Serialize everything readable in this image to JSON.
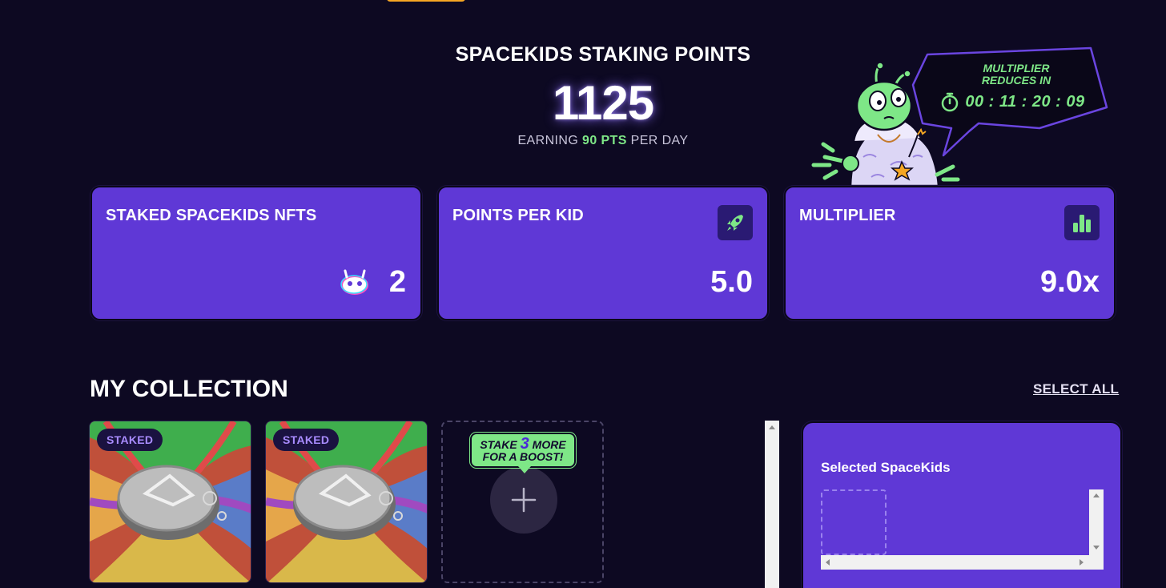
{
  "header": {
    "title": "SPACEKIDS STAKING POINTS",
    "points": "1125",
    "earning_prefix": "EARNING ",
    "earning_value": "90 PTS",
    "earning_suffix": " PER DAY"
  },
  "multiplier_bubble": {
    "label_line1": "MULTIPLIER",
    "label_line2": "REDUCES IN",
    "countdown": "00 : 11 : 20 : 09",
    "icon": "stopwatch-icon"
  },
  "stats": [
    {
      "label": "STAKED SPACEKIDS NFTS",
      "value": "2",
      "icon": "spacekid-icon"
    },
    {
      "label": "POINTS PER KID",
      "value": "5.0",
      "icon": "rocket-icon"
    },
    {
      "label": "MULTIPLIER",
      "value": "9.0x",
      "icon": "bar-chart-icon"
    }
  ],
  "collection": {
    "title": "MY COLLECTION",
    "select_all": "SELECT ALL",
    "items": [
      {
        "badge": "STAKED"
      },
      {
        "badge": "STAKED"
      }
    ],
    "boost_tip": {
      "line1_pre": "STAKE ",
      "count": "3",
      "line1_post": " MORE",
      "line2": "FOR A BOOST!"
    }
  },
  "selected_panel": {
    "title": "Selected SpaceKids"
  },
  "colors": {
    "background": "#0d0922",
    "card": "#5f38d6",
    "accent_green": "#7ee787",
    "icon_tile": "#2a1a73"
  }
}
